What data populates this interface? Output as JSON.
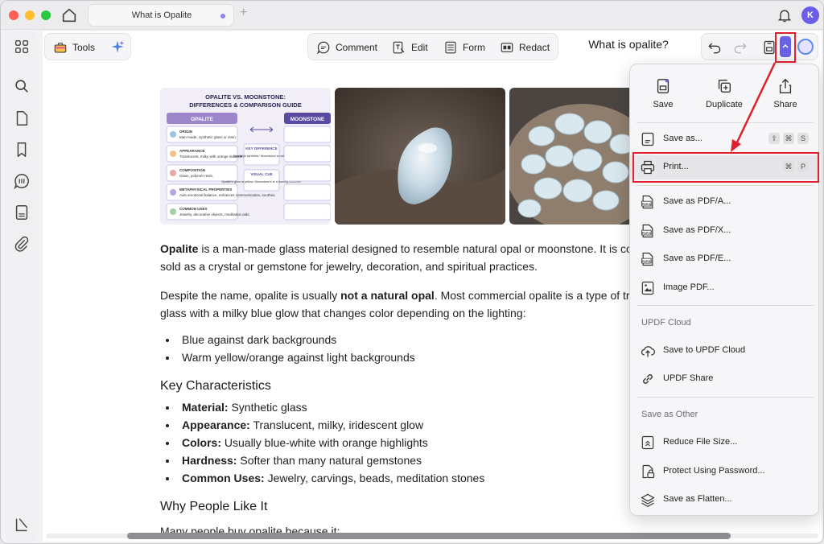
{
  "window": {
    "tab_title": "What is Opalite",
    "avatar_initial": "K"
  },
  "toolbar": {
    "tools_label": "Tools",
    "comment_label": "Comment",
    "edit_label": "Edit",
    "form_label": "Form",
    "redact_label": "Redact",
    "doc_title": "What is opalite?"
  },
  "infographic": {
    "title_line1": "OPALITE VS. MOONSTONE:",
    "title_line2": "DIFFERENCES & COMPARISON GUIDE",
    "col_left": "OPALITE",
    "col_right": "MOONSTONE",
    "rows": [
      {
        "label": "ORIGIN",
        "text": "Man-made, synthetic glass or resin."
      },
      {
        "label": "APPEARANCE",
        "text": "Translucent, milky with orange iridescence."
      },
      {
        "label": "COMPOSITION",
        "text": "Glass, polymer resin."
      },
      {
        "label": "METAPHYSICAL PROPERTIES",
        "text": "Aids emotional balance, enhances communication, soothes."
      },
      {
        "label": "COMMON USES",
        "text": "Jewelry, decorative objects, meditation aids."
      }
    ],
    "key_difference": "KEY DIFFERENCE",
    "key_text": "Opalite is synthetic. Moonstone is natural.",
    "visual_cue": "VISUAL CUE",
    "visual_text": "Opalite's glow is yellow; Moonstone's is a moving shimmer."
  },
  "article": {
    "p1_bold": "Opalite",
    "p1_rest": " is a man-made glass material designed to resemble natural opal or moonstone. It is com",
    "p1_line2": "sold as a crystal or gemstone for jewelry, decoration, and spiritual practices.",
    "p2_start": "Despite the name, opalite is usually ",
    "p2_bold": "not a natural opal",
    "p2_rest": ". Most commercial opalite is a type of tran",
    "p2_line2": "glass with a milky blue glow that changes color depending on the lighting:",
    "bullets1": [
      "Blue against dark backgrounds",
      "Warm yellow/orange against light backgrounds"
    ],
    "h_key": "Key Characteristics",
    "characteristics": [
      {
        "label": "Material:",
        "text": " Synthetic glass"
      },
      {
        "label": "Appearance:",
        "text": " Translucent, milky, iridescent glow"
      },
      {
        "label": "Colors:",
        "text": " Usually blue-white with orange highlights"
      },
      {
        "label": "Hardness:",
        "text": " Softer than many natural gemstones"
      },
      {
        "label": "Common Uses:",
        "text": " Jewelry, carvings, beads, meditation stones"
      }
    ],
    "h_why": "Why People Like It",
    "p3": "Many people buy opalite because it:"
  },
  "menu": {
    "save": "Save",
    "duplicate": "Duplicate",
    "share": "Share",
    "save_as": "Save as...",
    "save_as_keys": [
      "⇧",
      "⌘",
      "S"
    ],
    "print": "Print...",
    "print_keys": [
      "⌘",
      "P"
    ],
    "save_pdfa": "Save as PDF/A...",
    "save_pdfx": "Save as PDF/X...",
    "save_pdfe": "Save as PDF/E...",
    "image_pdf": "Image PDF...",
    "section_cloud": "UPDF Cloud",
    "save_cloud": "Save to UPDF Cloud",
    "updf_share": "UPDF Share",
    "section_other": "Save as Other",
    "reduce": "Reduce File Size...",
    "protect": "Protect Using Password...",
    "flatten": "Save as Flatten..."
  },
  "colors": {
    "accent": "#6a62e6",
    "highlight": "#e0202a"
  }
}
